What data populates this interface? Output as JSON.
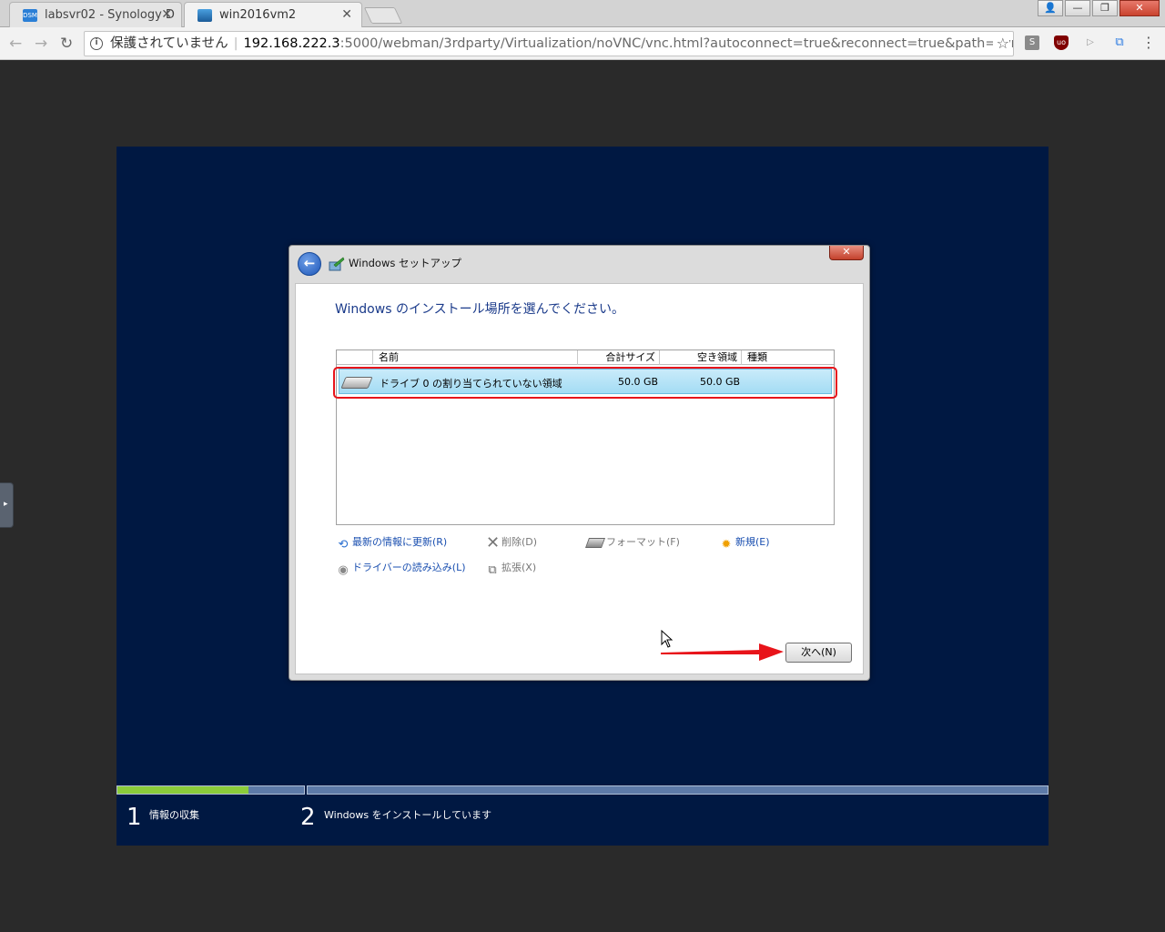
{
  "browser": {
    "tabs": [
      {
        "title": "labsvr02 - Synology D",
        "favicon": "dsm-icon",
        "favicon_text": "DSM",
        "active": false
      },
      {
        "title": "win2016vm2",
        "favicon": "vm-icon",
        "active": true
      }
    ],
    "tab_close": "✕",
    "window_controls": {
      "user": "👤",
      "minimize": "—",
      "restore": "❐",
      "close": "✕"
    },
    "nav": {
      "back": "←",
      "forward": "→",
      "reload": "↻"
    },
    "address": {
      "info": "i",
      "security_text": "保護されていません",
      "separator": "|",
      "host": "192.168.222.3",
      "path": ":5000/webman/3rdparty/Virtualization/noVNC/vnc.html?autoconnect=true&reconnect=true&path=synov",
      "star": "☆"
    },
    "extensions": [
      {
        "name": "s-extension-icon",
        "label": "S"
      },
      {
        "name": "ublock-icon",
        "label": "uo"
      },
      {
        "name": "pointer-extension-icon",
        "label": "▷"
      },
      {
        "name": "window-extension-icon",
        "label": "⧉"
      },
      {
        "name": "menu-icon",
        "label": "⋮"
      }
    ]
  },
  "vnc": {
    "side_handle": "▸",
    "dialog": {
      "title": "Windows セットアップ",
      "close": "✕",
      "back": "←",
      "heading": "Windows のインストール場所を選んでください。",
      "columns": [
        "名前",
        "合計サイズ",
        "空き領域",
        "種類"
      ],
      "rows": [
        {
          "name": "ドライブ 0 の割り当てられていない領域",
          "total": "50.0 GB",
          "free": "50.0 GB",
          "type": ""
        }
      ],
      "actions": {
        "refresh": "最新の情報に更新(R)",
        "delete": "削除(D)",
        "format": "フォーマット(F)",
        "new": "新規(E)",
        "load_driver": "ドライバーの読み込み(L)",
        "extend": "拡張(X)"
      },
      "next_button": "次へ(N)"
    },
    "progress": {
      "step1_fill": 0.7,
      "steps": [
        {
          "number": "1",
          "label": "情報の収集"
        },
        {
          "number": "2",
          "label": "Windows をインストールしています"
        }
      ]
    },
    "annotation_color": "#e8141a"
  }
}
